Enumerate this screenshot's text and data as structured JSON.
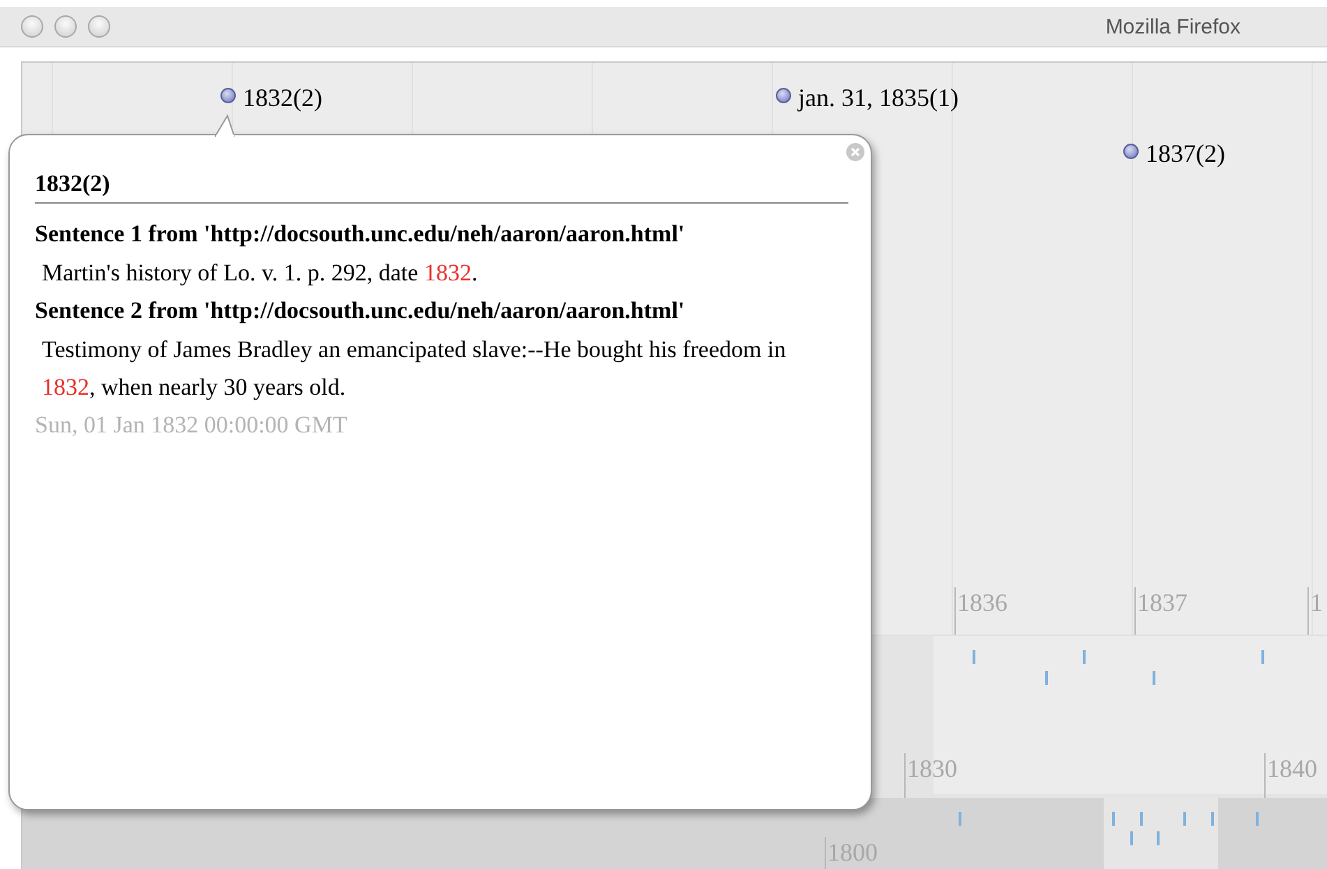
{
  "window": {
    "title": "Mozilla Firefox"
  },
  "events": [
    {
      "label": "1832(2)"
    },
    {
      "label": "jan. 31, 1835(1)"
    },
    {
      "label": "1837(2)"
    }
  ],
  "bands": [
    {
      "labels": [
        "1836",
        "1837",
        "1"
      ]
    },
    {
      "labels": [
        "1830",
        "1840"
      ]
    },
    {
      "labels": [
        "1800"
      ]
    }
  ],
  "popup": {
    "title": "1832(2)",
    "sentences": [
      {
        "heading": "Sentence 1 from 'http://docsouth.unc.edu/neh/aaron/aaron.html'",
        "parts": [
          {
            "text": "Martin's history of Lo. v. 1. p. 292, date ",
            "highlight": false
          },
          {
            "text": "1832",
            "highlight": true
          },
          {
            "text": ".",
            "highlight": false
          }
        ]
      },
      {
        "heading": "Sentence 2 from 'http://docsouth.unc.edu/neh/aaron/aaron.html'",
        "parts": [
          {
            "text": "Testimony of James Bradley an emancipated slave:--He bought his freedom in ",
            "highlight": false
          },
          {
            "text": "1832",
            "highlight": true
          },
          {
            "text": ", when nearly 30 years old.",
            "highlight": false
          }
        ]
      }
    ],
    "date": "Sun, 01 Jan 1832 00:00:00 GMT"
  }
}
